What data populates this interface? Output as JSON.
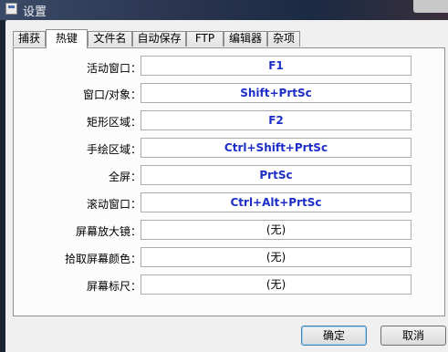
{
  "window": {
    "title": "设置"
  },
  "tabs": [
    {
      "label": "捕获"
    },
    {
      "label": "热键",
      "active": true
    },
    {
      "label": "文件名"
    },
    {
      "label": "自动保存"
    },
    {
      "label": "FTP"
    },
    {
      "label": "编辑器"
    },
    {
      "label": "杂项"
    }
  ],
  "hotkeys": [
    {
      "label": "活动窗口：",
      "value": "F1"
    },
    {
      "label": "窗口/对象：",
      "value": "Shift+PrtSc"
    },
    {
      "label": "矩形区域：",
      "value": "F2"
    },
    {
      "label": "手绘区域：",
      "value": "Ctrl+Shift+PrtSc"
    },
    {
      "label": "全屏：",
      "value": "PrtSc"
    },
    {
      "label": "滚动窗口：",
      "value": "Ctrl+Alt+PrtSc"
    },
    {
      "label": "屏幕放大镜：",
      "value": "(无)"
    },
    {
      "label": "拾取屏幕颜色：",
      "value": "(无)"
    },
    {
      "label": "屏幕标尺：",
      "value": "(无)"
    }
  ],
  "buttons": {
    "ok": "确定",
    "cancel": "取消"
  },
  "colors": {
    "hotkey_text": "#1d2ec8"
  }
}
